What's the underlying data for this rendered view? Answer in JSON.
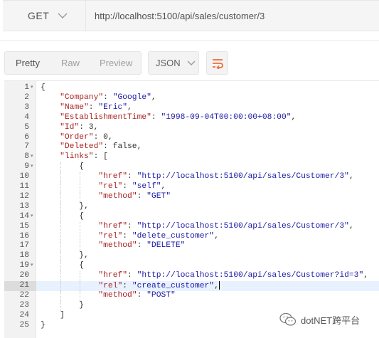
{
  "request": {
    "method": "GET",
    "url": "http://localhost:5100/api/sales/customer/3"
  },
  "response_toolbar": {
    "tabs": [
      {
        "label": "Pretty",
        "active": true
      },
      {
        "label": "Raw",
        "active": false
      },
      {
        "label": "Preview",
        "active": false
      }
    ],
    "format": "JSON",
    "wrap_icon": "wrap-lines-icon"
  },
  "editor": {
    "highlighted_line": 21,
    "lines": [
      {
        "n": "1",
        "fold": true,
        "indent": 0,
        "tokens": [
          [
            "p",
            "{"
          ]
        ]
      },
      {
        "n": "2",
        "fold": false,
        "indent": 1,
        "tokens": [
          [
            "k",
            "\"Company\""
          ],
          [
            "p",
            ": "
          ],
          [
            "s",
            "\"Google\""
          ],
          [
            "p",
            ","
          ]
        ]
      },
      {
        "n": "3",
        "fold": false,
        "indent": 1,
        "tokens": [
          [
            "k",
            "\"Name\""
          ],
          [
            "p",
            ": "
          ],
          [
            "s",
            "\"Eric\""
          ],
          [
            "p",
            ","
          ]
        ]
      },
      {
        "n": "4",
        "fold": false,
        "indent": 1,
        "tokens": [
          [
            "k",
            "\"EstablishmentTime\""
          ],
          [
            "p",
            ": "
          ],
          [
            "s",
            "\"1998-09-04T00:00:00+08:00\""
          ],
          [
            "p",
            ","
          ]
        ]
      },
      {
        "n": "5",
        "fold": false,
        "indent": 1,
        "tokens": [
          [
            "k",
            "\"Id\""
          ],
          [
            "p",
            ": 3,"
          ]
        ]
      },
      {
        "n": "6",
        "fold": false,
        "indent": 1,
        "tokens": [
          [
            "k",
            "\"Order\""
          ],
          [
            "p",
            ": 0,"
          ]
        ]
      },
      {
        "n": "7",
        "fold": false,
        "indent": 1,
        "tokens": [
          [
            "k",
            "\"Deleted\""
          ],
          [
            "p",
            ": false,"
          ]
        ]
      },
      {
        "n": "8",
        "fold": true,
        "indent": 1,
        "tokens": [
          [
            "k",
            "\"links\""
          ],
          [
            "p",
            ": ["
          ]
        ]
      },
      {
        "n": "9",
        "fold": true,
        "indent": 2,
        "tokens": [
          [
            "p",
            "{"
          ]
        ]
      },
      {
        "n": "10",
        "fold": false,
        "indent": 3,
        "tokens": [
          [
            "k",
            "\"href\""
          ],
          [
            "p",
            ": "
          ],
          [
            "s",
            "\"http://localhost:5100/api/sales/Customer/3\""
          ],
          [
            "p",
            ","
          ]
        ]
      },
      {
        "n": "11",
        "fold": false,
        "indent": 3,
        "tokens": [
          [
            "k",
            "\"rel\""
          ],
          [
            "p",
            ": "
          ],
          [
            "s",
            "\"self\""
          ],
          [
            "p",
            ","
          ]
        ]
      },
      {
        "n": "12",
        "fold": false,
        "indent": 3,
        "tokens": [
          [
            "k",
            "\"method\""
          ],
          [
            "p",
            ": "
          ],
          [
            "s",
            "\"GET\""
          ]
        ]
      },
      {
        "n": "13",
        "fold": false,
        "indent": 2,
        "tokens": [
          [
            "p",
            "},"
          ]
        ]
      },
      {
        "n": "14",
        "fold": true,
        "indent": 2,
        "tokens": [
          [
            "p",
            "{"
          ]
        ]
      },
      {
        "n": "15",
        "fold": false,
        "indent": 3,
        "tokens": [
          [
            "k",
            "\"href\""
          ],
          [
            "p",
            ": "
          ],
          [
            "s",
            "\"http://localhost:5100/api/sales/Customer/3\""
          ],
          [
            "p",
            ","
          ]
        ]
      },
      {
        "n": "16",
        "fold": false,
        "indent": 3,
        "tokens": [
          [
            "k",
            "\"rel\""
          ],
          [
            "p",
            ": "
          ],
          [
            "s",
            "\"delete_customer\""
          ],
          [
            "p",
            ","
          ]
        ]
      },
      {
        "n": "17",
        "fold": false,
        "indent": 3,
        "tokens": [
          [
            "k",
            "\"method\""
          ],
          [
            "p",
            ": "
          ],
          [
            "s",
            "\"DELETE\""
          ]
        ]
      },
      {
        "n": "18",
        "fold": false,
        "indent": 2,
        "tokens": [
          [
            "p",
            "},"
          ]
        ]
      },
      {
        "n": "19",
        "fold": true,
        "indent": 2,
        "tokens": [
          [
            "p",
            "{"
          ]
        ]
      },
      {
        "n": "20",
        "fold": false,
        "indent": 3,
        "tokens": [
          [
            "k",
            "\"href\""
          ],
          [
            "p",
            ": "
          ],
          [
            "s",
            "\"http://localhost:5100/api/sales/Customer?id=3\""
          ],
          [
            "p",
            ","
          ]
        ]
      },
      {
        "n": "21",
        "fold": false,
        "indent": 3,
        "tokens": [
          [
            "k",
            "\"rel\""
          ],
          [
            "p",
            ": "
          ],
          [
            "s",
            "\"create_customer\""
          ],
          [
            "p",
            ","
          ]
        ],
        "cursor": true
      },
      {
        "n": "22",
        "fold": false,
        "indent": 3,
        "tokens": [
          [
            "k",
            "\"method\""
          ],
          [
            "p",
            ": "
          ],
          [
            "s",
            "\"POST\""
          ]
        ]
      },
      {
        "n": "23",
        "fold": false,
        "indent": 2,
        "tokens": [
          [
            "p",
            "}"
          ]
        ]
      },
      {
        "n": "24",
        "fold": false,
        "indent": 1,
        "tokens": [
          [
            "p",
            "]"
          ]
        ]
      },
      {
        "n": "25",
        "fold": false,
        "indent": 0,
        "tokens": [
          [
            "p",
            "}"
          ]
        ]
      }
    ]
  },
  "watermark": {
    "text": "dotNET跨平台",
    "icon": "wechat-official-account-icon"
  },
  "colors": {
    "key": "#aa2222",
    "string": "#1a1aa6",
    "accent": "#f26b3a"
  }
}
